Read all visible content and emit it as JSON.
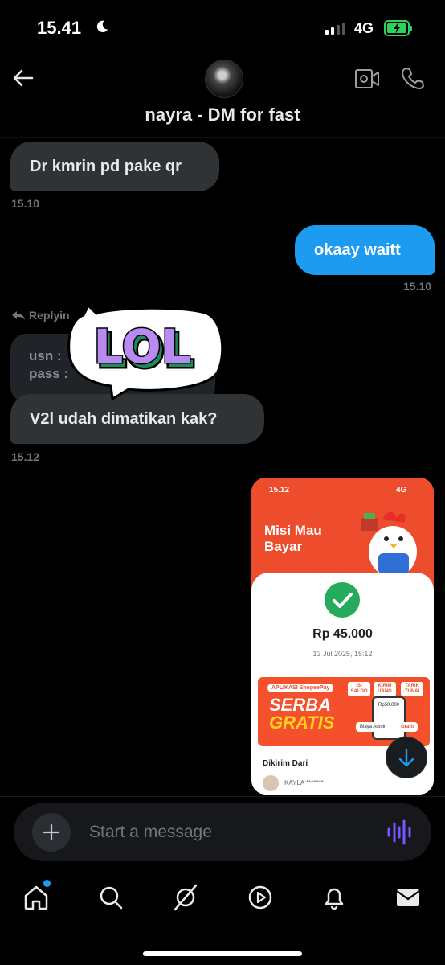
{
  "status_bar": {
    "time": "15.41",
    "network": "4G"
  },
  "header": {
    "title": "nayra - DM for fast"
  },
  "messages": [
    {
      "text": "Dr kmrin pd pake qr",
      "time": "15.10"
    },
    {
      "text": "okaay waitt",
      "time": "15.10"
    },
    {
      "replying": "Replyin",
      "quote_line1": "usn :",
      "quote_line2": "pass :",
      "text": "V2l udah dimatikan kak?",
      "time": "15.12"
    }
  ],
  "sticker": {
    "text": "LOL"
  },
  "image_card": {
    "time": "15.12",
    "network": "4G",
    "title": "Misi Mau Bayar",
    "amount": "Rp 45.000",
    "date": "13 Jul 2025, 15:12",
    "banner_app": "APLIKASI ShopeePay",
    "banner_line1": "SERBA",
    "banner_line2": "GRATIS",
    "chip1": "ISI SALDO",
    "chip2": "KIRIM UANG",
    "chip3": "TARIK TUNAI",
    "mini_amount": "Rp50.000",
    "biaya": "Biaya Admin",
    "gratis": "Gratis",
    "sender_label": "Dikirim Dari",
    "sender_name": "KAYLA *******"
  },
  "composer": {
    "placeholder": "Start a message"
  },
  "nav": [
    "home-icon",
    "search-icon",
    "grok-icon",
    "video-icon",
    "notifications-icon",
    "messages-icon"
  ],
  "colors": {
    "accent": "#1d9bf0",
    "incoming_bubble": "#2f3336",
    "timestamp": "#71767b",
    "shopee": "#ee4d2d"
  }
}
